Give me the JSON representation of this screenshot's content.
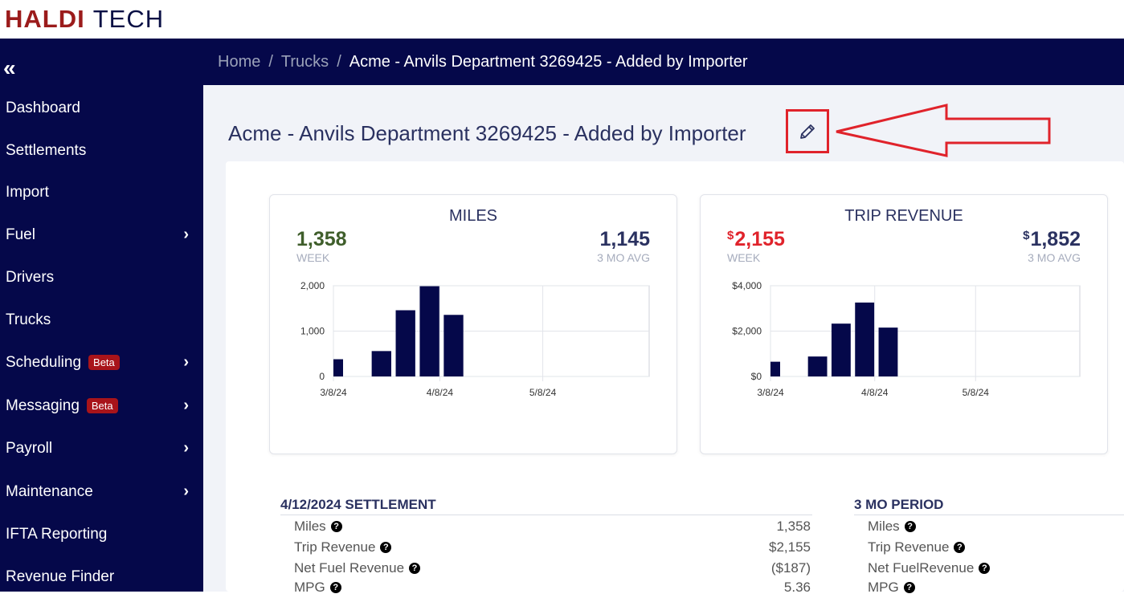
{
  "brand": {
    "part1": "HALDI",
    "part2": "TECH"
  },
  "sidebar": {
    "collapse_icon": "double-chevron-left-icon",
    "items": [
      {
        "label": "Dashboard",
        "badge": "",
        "has_submenu": false
      },
      {
        "label": "Settlements",
        "badge": "",
        "has_submenu": false
      },
      {
        "label": "Import",
        "badge": "",
        "has_submenu": false
      },
      {
        "label": "Fuel",
        "badge": "",
        "has_submenu": true
      },
      {
        "label": "Drivers",
        "badge": "",
        "has_submenu": false
      },
      {
        "label": "Trucks",
        "badge": "",
        "has_submenu": false
      },
      {
        "label": "Scheduling",
        "badge": "Beta",
        "has_submenu": true
      },
      {
        "label": "Messaging",
        "badge": "Beta",
        "has_submenu": true
      },
      {
        "label": "Payroll",
        "badge": "",
        "has_submenu": true
      },
      {
        "label": "Maintenance",
        "badge": "",
        "has_submenu": true
      },
      {
        "label": "IFTA Reporting",
        "badge": "",
        "has_submenu": false
      },
      {
        "label": "Revenue Finder",
        "badge": "",
        "has_submenu": false
      }
    ]
  },
  "breadcrumb": {
    "home": "Home",
    "sep": "/",
    "trucks": "Trucks",
    "current": "Acme - Anvils Department 3269425 - Added by Importer"
  },
  "page": {
    "title": "Acme - Anvils Department 3269425 - Added by Importer",
    "edit_icon": "pencil-icon"
  },
  "colors": {
    "navy": "#05084a",
    "green": "#3f5e2b",
    "red": "#e0232b",
    "bar": "#05084a",
    "badge": "#a8141a"
  },
  "miles_card": {
    "title": "MILES",
    "week_value": "1,358",
    "week_label": "WEEK",
    "avg_value": "1,145",
    "avg_label": "3 MO AVG"
  },
  "revenue_card": {
    "title": "TRIP REVENUE",
    "currency": "$",
    "week_value": "2,155",
    "week_label": "WEEK",
    "avg_value": "1,852",
    "avg_label": "3 MO AVG"
  },
  "chart_data": [
    {
      "type": "bar",
      "x_ticks": [
        "3/8/24",
        "4/8/24",
        "5/8/24"
      ],
      "y_ticks": [
        "0",
        "1,000",
        "2,000"
      ],
      "ylim": [
        0,
        2000
      ],
      "series": [
        {
          "values": [
            380,
            560,
            1460,
            1990,
            1358
          ]
        }
      ],
      "x_days": [
        0,
        14,
        21,
        28,
        35
      ],
      "x_range_days": [
        0,
        92
      ],
      "grid": true
    },
    {
      "type": "bar",
      "x_ticks": [
        "3/8/24",
        "4/8/24",
        "5/8/24"
      ],
      "y_ticks": [
        "$0",
        "$2,000",
        "$4,000"
      ],
      "ylim": [
        0,
        4000
      ],
      "series": [
        {
          "values": [
            650,
            880,
            2330,
            3260,
            2155
          ]
        }
      ],
      "x_days": [
        0,
        14,
        21,
        28,
        35
      ],
      "x_range_days": [
        0,
        92
      ],
      "grid": true
    }
  ],
  "settlement": {
    "title": "4/12/2024 SETTLEMENT",
    "rows": [
      {
        "label": "Miles",
        "value": "1,358"
      },
      {
        "label": "Trip Revenue",
        "value": "$2,155"
      },
      {
        "label": "Net Fuel Revenue",
        "value": "($187)"
      },
      {
        "label": "MPG",
        "value": "5.36"
      }
    ]
  },
  "period": {
    "title": "3 MO PERIOD",
    "rows": [
      {
        "label": "Miles"
      },
      {
        "label": "Trip Revenue"
      },
      {
        "label": "Net FuelRevenue"
      },
      {
        "label": "MPG"
      }
    ]
  },
  "help_icon": "?"
}
